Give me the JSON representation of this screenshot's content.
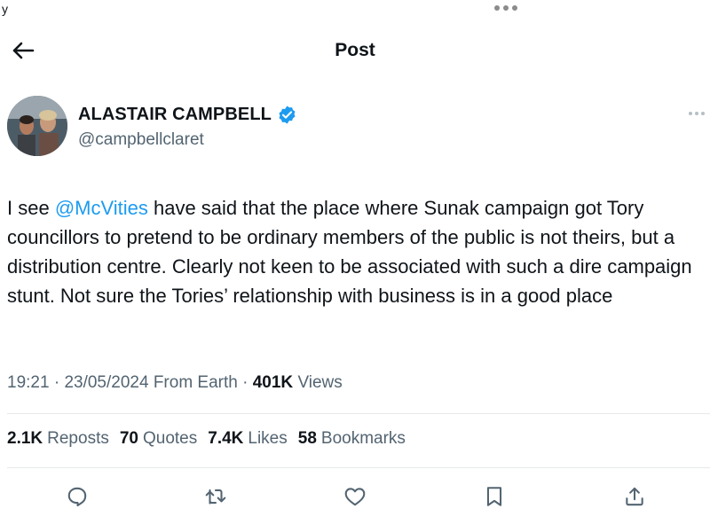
{
  "status_bar": {
    "left_text": "y"
  },
  "header": {
    "title": "Post"
  },
  "author": {
    "name": "ALASTAIR CAMPBELL",
    "handle": "@campbellclaret",
    "verified_color": "#1d9bf0"
  },
  "tweet": {
    "text_before": "I see ",
    "mention": "@McVities",
    "text_after": " have said that the place where Sunak campaign got Tory councillors to pretend to be ordinary members of the public is not theirs, but a distribution centre. Clearly not keen to be associated with such a dire campaign stunt. Not sure the Tories’ relationship with business is in a good place",
    "time": "19:21",
    "date": "23/05/2024",
    "location": "From Earth",
    "views_count": "401K",
    "views_label": "Views"
  },
  "stats": {
    "reposts_count": "2.1K",
    "reposts_label": "Reposts",
    "quotes_count": "70",
    "quotes_label": "Quotes",
    "likes_count": "7.4K",
    "likes_label": "Likes",
    "bookmarks_count": "58",
    "bookmarks_label": "Bookmarks"
  },
  "icons": {
    "back": "arrow-left-icon",
    "verified": "verified-badge-icon",
    "more": "more-horizontal-icon",
    "reply": "reply-icon",
    "repost": "repost-icon",
    "like": "heart-icon",
    "bookmark": "bookmark-icon",
    "share": "share-icon"
  },
  "colors": {
    "link": "#1d9bf0",
    "secondary_text": "#536471",
    "primary_text": "#0f1419"
  }
}
